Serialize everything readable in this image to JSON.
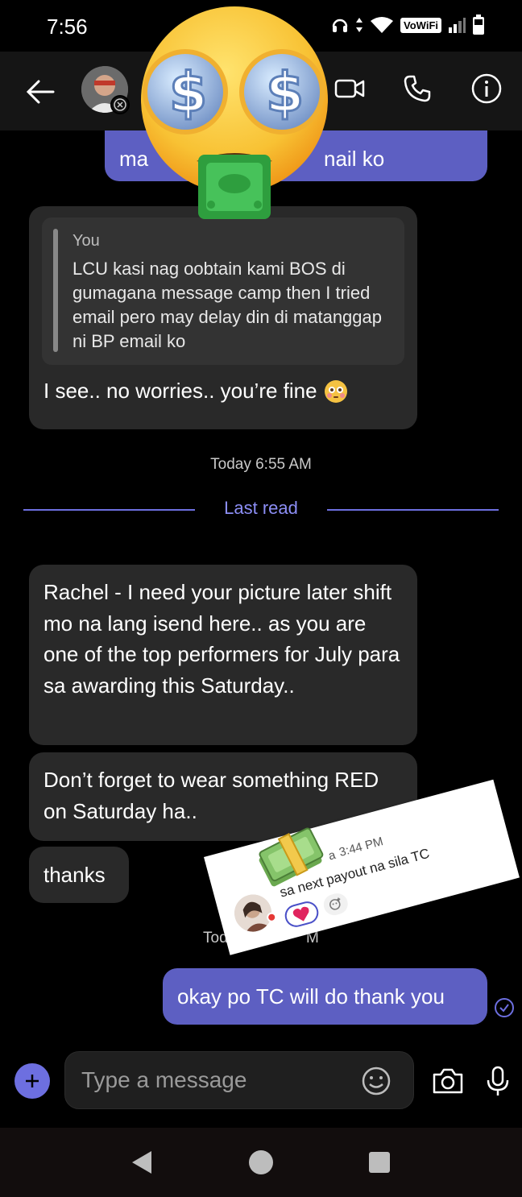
{
  "status": {
    "time": "7:56",
    "vowifi": "VoWiFi"
  },
  "header": {
    "back": "back-arrow-icon",
    "video": "video-icon",
    "call": "phone-icon",
    "info": "info-icon"
  },
  "messages": {
    "sent_top_left": "ma",
    "sent_top_right": "nail ko",
    "quote_name": "You",
    "quote_text": "LCU kasi nag oobtain kami BOS di gumagana message camp then I tried email pero may delay din di matanggap ni BP email ko",
    "reply_text": "I see.. no worries.. you’re fine",
    "timestamp_1": "Today 6:55 AM",
    "last_read": "Last read",
    "msg_1": "Rachel - I need your picture later shift mo na lang isend here.. as you are one of the top performers for July para sa awarding this Saturday..",
    "msg_2": "Don’t forget to wear something RED on Saturday ha..",
    "msg_3": "thanks",
    "timestamp_2_left": "Tod",
    "timestamp_2_right": "M",
    "sent_reply": "okay po TC will do thank you"
  },
  "sticker": {
    "name_tail": "a",
    "time": "3:44 PM",
    "text": "sa next payout na sila TC"
  },
  "composer": {
    "placeholder": "Type a message"
  },
  "colors": {
    "accent": "#5d5fc2",
    "incoming": "#292929",
    "last_read": "#8c8ef5"
  }
}
